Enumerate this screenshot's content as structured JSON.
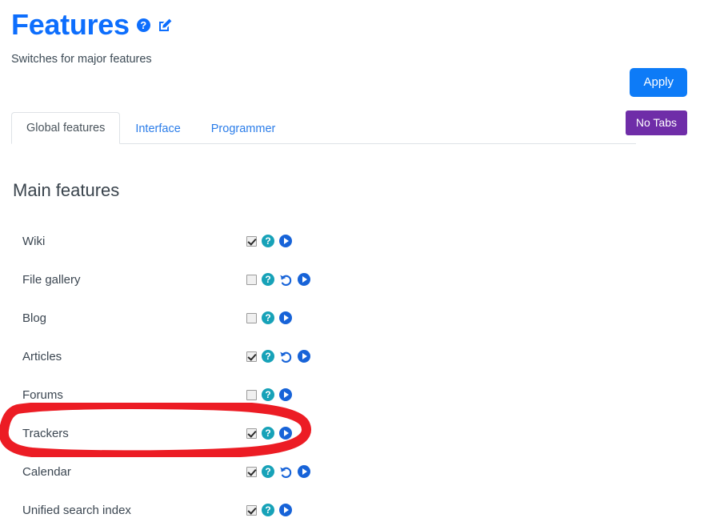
{
  "header": {
    "title": "Features",
    "subtitle": "Switches for major features",
    "help_icon": "help-circle-icon",
    "edit_icon": "edit-pencil-icon"
  },
  "actions": {
    "apply_label": "Apply",
    "apply_color": "#0d7bf7",
    "no_tabs_label": "No Tabs",
    "no_tabs_color": "#6f2da8"
  },
  "tabs": [
    {
      "label": "Global features",
      "active": true
    },
    {
      "label": "Interface",
      "active": false
    },
    {
      "label": "Programmer",
      "active": false
    }
  ],
  "section": {
    "title": "Main features"
  },
  "colors": {
    "link": "#2b7de9",
    "title": "#0d6efd",
    "help_teal": "#17a2b8",
    "play_blue": "#1763d8",
    "undo_blue": "#1763d8",
    "annotation_red": "#ec1c24"
  },
  "icons": {
    "help": "help-circle-icon",
    "undo": "undo-arrow-icon",
    "play": "play-circle-icon"
  },
  "features": [
    {
      "label": "Wiki",
      "checked": true,
      "has_undo": false
    },
    {
      "label": "File gallery",
      "checked": false,
      "has_undo": true
    },
    {
      "label": "Blog",
      "checked": false,
      "has_undo": false
    },
    {
      "label": "Articles",
      "checked": true,
      "has_undo": true
    },
    {
      "label": "Forums",
      "checked": false,
      "has_undo": false
    },
    {
      "label": "Trackers",
      "checked": true,
      "has_undo": false
    },
    {
      "label": "Calendar",
      "checked": true,
      "has_undo": true
    },
    {
      "label": "Unified search index",
      "checked": true,
      "has_undo": false
    }
  ],
  "annotation": {
    "shape": "ellipse",
    "target": "Trackers",
    "color": "#ec1c24"
  }
}
